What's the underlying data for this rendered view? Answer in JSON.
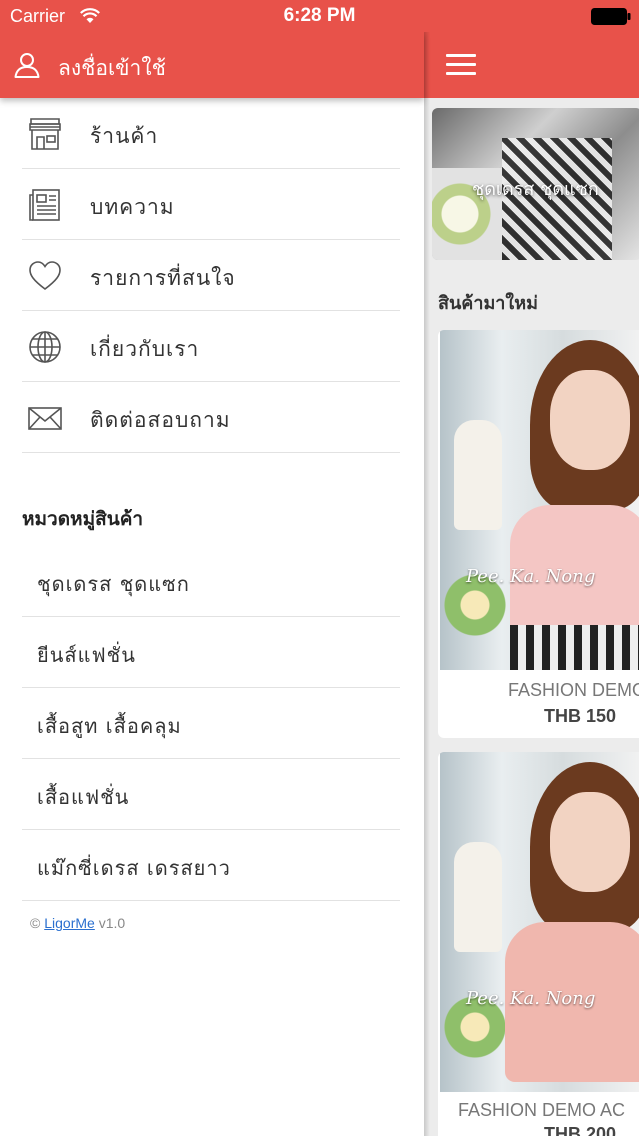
{
  "status_bar": {
    "carrier": "Carrier",
    "time": "6:28 PM"
  },
  "drawer": {
    "login_label": "ลงชื่อเข้าใช้",
    "menu": [
      {
        "label": "ร้านค้า",
        "icon": "store-icon"
      },
      {
        "label": "บทความ",
        "icon": "newspaper-icon"
      },
      {
        "label": "รายการที่สนใจ",
        "icon": "heart-icon"
      },
      {
        "label": "เกี่ยวกับเรา",
        "icon": "globe-icon"
      },
      {
        "label": "ติดต่อสอบถาม",
        "icon": "envelope-icon"
      }
    ],
    "categories_title": "หมวดหมู่สินค้า",
    "categories": [
      "ชุดเดรส ชุดแซก",
      "ยีนส์แฟชั่น",
      "เสื้อสูท เสื้อคลุม",
      "เสื้อแฟชั่น",
      "แม๊กซี่เดรส เดรสยาว"
    ],
    "footer": {
      "copyright": "©",
      "brand": "LigorMe",
      "version": "v1.0"
    }
  },
  "main": {
    "banner_label": "ชุดเดรส ชุดแซก",
    "section_title": "สินค้ามาใหม่",
    "products": [
      {
        "name": "FASHION DEMO",
        "price": "THB 150",
        "watermark": "Pee. Ka. Nong"
      },
      {
        "name": "FASHION DEMO AC",
        "price": "THB 200",
        "watermark": "Pee. Ka. Nong"
      }
    ]
  },
  "colors": {
    "brand": "#e8524a",
    "divider": "#e2e2e2",
    "link": "#2a6fcf"
  }
}
